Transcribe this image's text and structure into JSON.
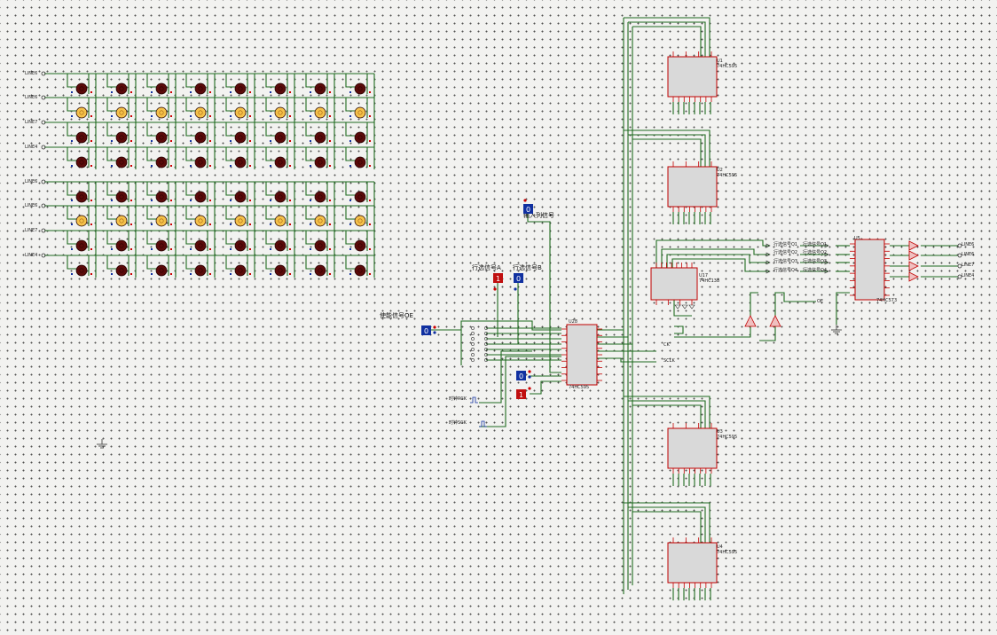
{
  "colors": {
    "wire": "#1f6b1f",
    "ic_fill": "#d9d9d9",
    "ic_border": "#c00000",
    "led_off": "#5a0a0a",
    "led_on": "#f5c14a",
    "input_blue": "#1030a0",
    "input_red": "#c01010"
  },
  "led_matrix": {
    "row_labels_top": [
      "LINE6",
      "LINE6",
      "LINE7",
      "LINE4"
    ],
    "row_labels_bottom": [
      "LINE6",
      "LINE6",
      "LINE7",
      "LINE4"
    ],
    "columns": 8,
    "lit_rows_top": [
      1
    ],
    "lit_rows_bottom": [
      1
    ]
  },
  "inputs": {
    "enable": {
      "label": "使能信号OE",
      "value": "0"
    },
    "input_row": {
      "label": "输入列信号",
      "value": "0"
    },
    "row_a": {
      "label": "行选信号A",
      "value": "1"
    },
    "row_b": {
      "label": "行选信号B",
      "value": "0"
    },
    "ctrl_0": {
      "value": "0"
    },
    "ctrl_1": {
      "value": "1"
    },
    "clock_rck": {
      "label": "时钟RCK"
    },
    "clock_sck": {
      "label": "时钟SCK"
    }
  },
  "chips": {
    "u1": {
      "name": "U1",
      "part": "74HC595"
    },
    "u2": {
      "name": "U2",
      "part": "74HC595"
    },
    "u3": {
      "name": "U3",
      "part": "74HC595"
    },
    "u4": {
      "name": "U4",
      "part": "74HC595"
    },
    "u5": {
      "name": "U5",
      "part": "74HC573"
    },
    "u17": {
      "name": "U17",
      "part": "74HC138"
    },
    "u28": {
      "name": "U28",
      "part": "74HC595"
    }
  },
  "nets": {
    "ck": "CK",
    "sclk": "SCLK",
    "oe": "OE",
    "q1": "行选信号Q1",
    "q2": "行选信号Q2",
    "q3": "行选信号Q3",
    "q4": "行选信号Q4"
  },
  "outputs": [
    "LINE6",
    "LINE6",
    "LINE7",
    "LINE4"
  ]
}
